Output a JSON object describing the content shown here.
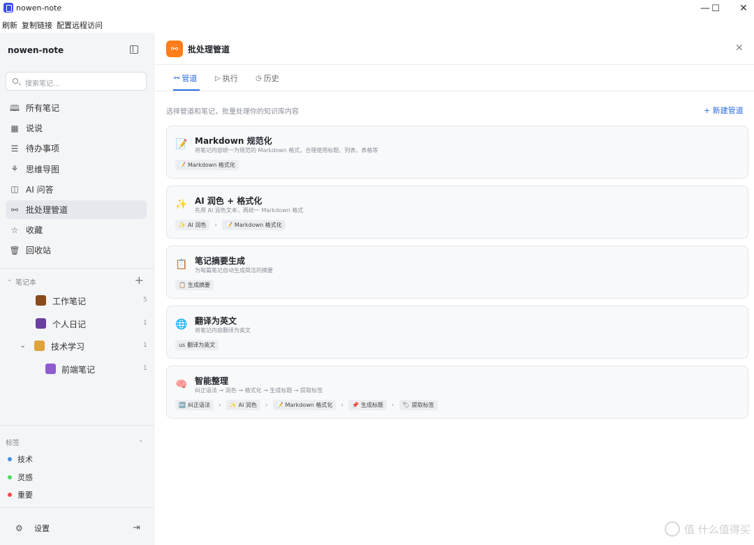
{
  "window": {
    "title": "nowen-note",
    "minimize": "—",
    "maximize": "☐",
    "close": "✕"
  },
  "menu": [
    "刷新",
    "复制链接",
    "配置远程访问"
  ],
  "sidebar": {
    "app_name": "nowen-note",
    "search_placeholder": "搜索笔记...",
    "nav": [
      {
        "label": "所有笔记",
        "icon": "book-open-icon",
        "glyph": "🕮"
      },
      {
        "label": "说说",
        "icon": "calendar-icon",
        "glyph": "▦"
      },
      {
        "label": "待办事项",
        "icon": "checklist-icon",
        "glyph": "☰"
      },
      {
        "label": "思维导图",
        "icon": "mindmap-icon",
        "glyph": "⚘"
      },
      {
        "label": "AI 问答",
        "icon": "bot-icon",
        "glyph": "◫"
      },
      {
        "label": "批处理管道",
        "icon": "workflow-icon",
        "glyph": "⚯"
      },
      {
        "label": "收藏",
        "icon": "star-icon",
        "glyph": "☆"
      },
      {
        "label": "回收站",
        "icon": "trash-icon",
        "glyph": "🗑"
      }
    ],
    "active_index": 5,
    "notebooks_label": "笔记本",
    "add_label": "+",
    "notebooks": [
      {
        "label": "工作笔记",
        "count": "5",
        "icon": "briefcase-icon",
        "color": "#8a4b1c"
      },
      {
        "label": "个人日记",
        "count": "1",
        "icon": "diary-icon",
        "color": "#6b3fa0"
      },
      {
        "label": "技术学习",
        "count": "1",
        "icon": "technologist-icon",
        "color": "#e0a23a"
      },
      {
        "label": "前端笔记",
        "count": "1",
        "icon": "react-icon",
        "color": "#8e5bd0"
      }
    ],
    "tags_label": "标签",
    "tags": [
      {
        "label": "技术",
        "color": "#4a90e2"
      },
      {
        "label": "灵感",
        "color": "#4cd964"
      },
      {
        "label": "重要",
        "color": "#f04a4a"
      }
    ],
    "settings_label": "设置"
  },
  "main": {
    "title": "批处理管道",
    "tabs": [
      {
        "label": "管道",
        "glyph": "⚯"
      },
      {
        "label": "执行",
        "glyph": "▷"
      },
      {
        "label": "历史",
        "glyph": "◷"
      }
    ],
    "intro": "选择管道和笔记，批量处理你的知识库内容",
    "new_button": "+ 新建管道",
    "pipelines": [
      {
        "title": "Markdown 规范化",
        "desc": "将笔记内容统一为规范的 Markdown 格式，合理使用标题、列表、表格等",
        "icon": "memo-icon",
        "glyph": "📝",
        "steps": [
          {
            "glyph": "📝",
            "label": "Markdown 格式化"
          }
        ]
      },
      {
        "title": "AI 润色 + 格式化",
        "desc": "先用 AI 润色文本，再统一 Markdown 格式",
        "icon": "sparkles-icon",
        "glyph": "✨",
        "steps": [
          {
            "glyph": "✨",
            "label": "AI 润色"
          },
          {
            "glyph": "📝",
            "label": "Markdown 格式化"
          }
        ]
      },
      {
        "title": "笔记摘要生成",
        "desc": "为每篇笔记自动生成简洁的摘要",
        "icon": "clipboard-icon",
        "glyph": "📋",
        "steps": [
          {
            "glyph": "📋",
            "label": "生成摘要"
          }
        ]
      },
      {
        "title": "翻译为英文",
        "desc": "将笔记内容翻译为英文",
        "icon": "globe-icon",
        "glyph": "🌐",
        "steps": [
          {
            "glyph": "us",
            "label": "翻译为英文"
          }
        ]
      },
      {
        "title": "智能整理",
        "desc": "纠正语法 → 润色 → 格式化 → 生成标题 → 提取标签",
        "icon": "brain-icon",
        "glyph": "🧠",
        "steps": [
          {
            "glyph": "🔤",
            "label": "纠正语法"
          },
          {
            "glyph": "✨",
            "label": "AI 润色"
          },
          {
            "glyph": "📝",
            "label": "Markdown 格式化"
          },
          {
            "glyph": "📌",
            "label": "生成标题"
          },
          {
            "glyph": "🏷",
            "label": "提取标签"
          }
        ]
      }
    ],
    "step_separator": "›"
  },
  "watermark": "值 什么值得买"
}
